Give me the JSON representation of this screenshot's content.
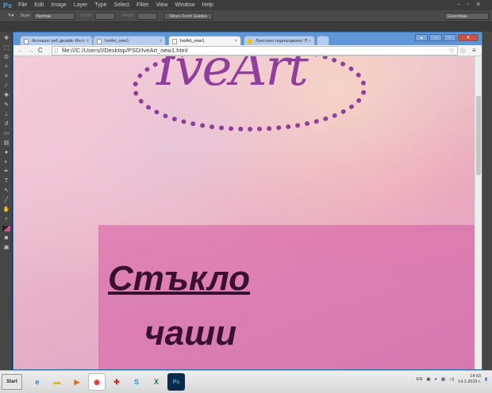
{
  "photoshop": {
    "logo": "Ps",
    "menu": [
      "File",
      "Edit",
      "Image",
      "Layer",
      "Type",
      "Select",
      "Filter",
      "View",
      "Window",
      "Help"
    ],
    "options": {
      "style_label": "Style:",
      "style_value": "Normal",
      "width_label": "Width:",
      "height_label": "Height:",
      "slices_button": "Slices From Guides",
      "workspace": "Essentials"
    }
  },
  "browser": {
    "tabs": [
      {
        "label": "Фотошоп уеб дизайн Инст"
      },
      {
        "label": "IvéArt_new1"
      },
      {
        "label": "IvéArt_new1",
        "active": true
      },
      {
        "label": "Луксозно подпалдване! П"
      }
    ],
    "url": "file:///C:/Users/I/Desktop/PSD/IvéArt_new1.html"
  },
  "page": {
    "logo_text": "IvéArt",
    "heading_line1": "Стъкло",
    "heading_line2": "чаши"
  },
  "taskbar": {
    "start": "Start",
    "lang": "EN",
    "time": "14:03",
    "date": "14.1.2015 г."
  }
}
